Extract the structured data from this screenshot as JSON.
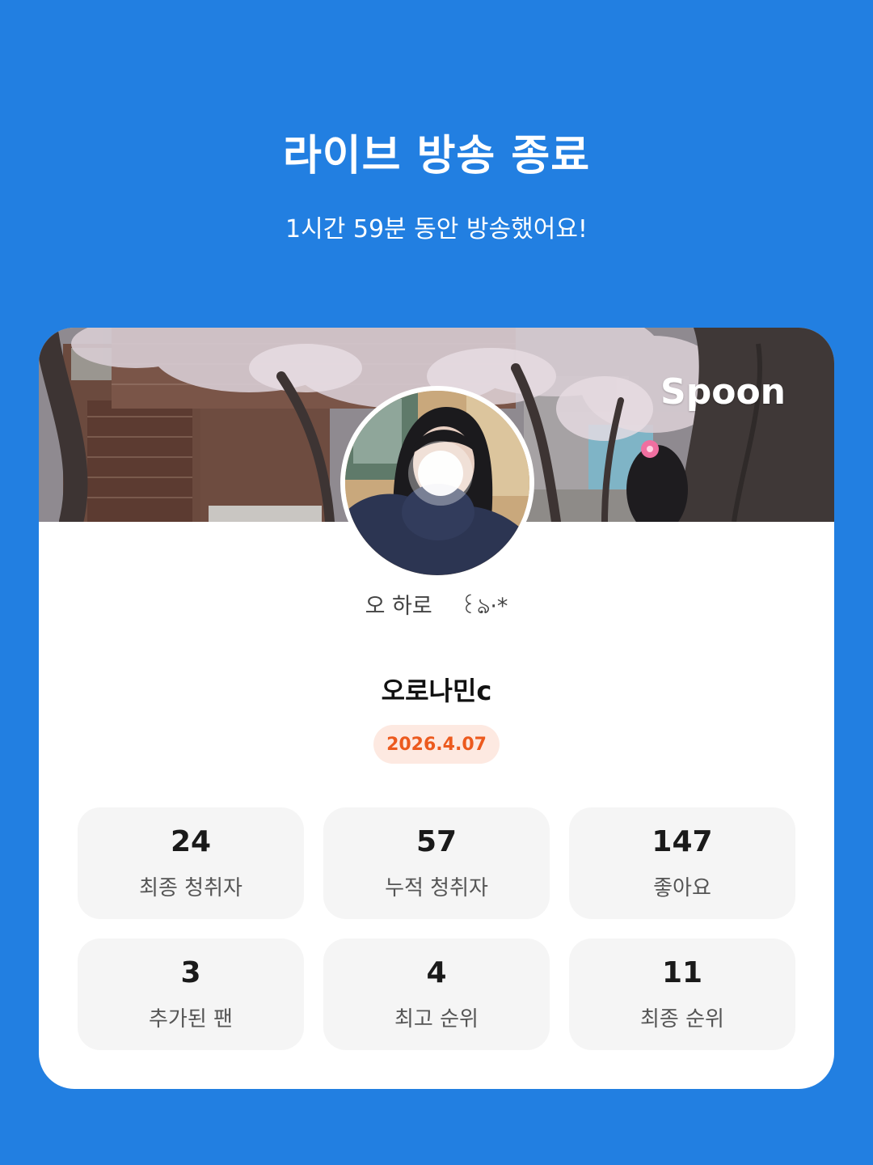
{
  "header": {
    "title": "라이브 방송 종료",
    "subtitle": "1시간 59분 동안 방송했어요!"
  },
  "card": {
    "brand": "Spoon",
    "status_message": "오 하로    ꒰ঌ·*",
    "nickname": "오로나민c",
    "date": "2026.4.07",
    "stats": [
      {
        "value": "24",
        "label": "최종 청취자"
      },
      {
        "value": "57",
        "label": "누적 청취자"
      },
      {
        "value": "147",
        "label": "좋아요"
      },
      {
        "value": "3",
        "label": "추가된 팬"
      },
      {
        "value": "4",
        "label": "최고 순위"
      },
      {
        "value": "11",
        "label": "최종 순위"
      }
    ]
  },
  "colors": {
    "background": "#227fe1",
    "date_text": "#ec5a1e",
    "date_bg": "#fde9e1",
    "stat_bg": "#f5f5f5"
  }
}
